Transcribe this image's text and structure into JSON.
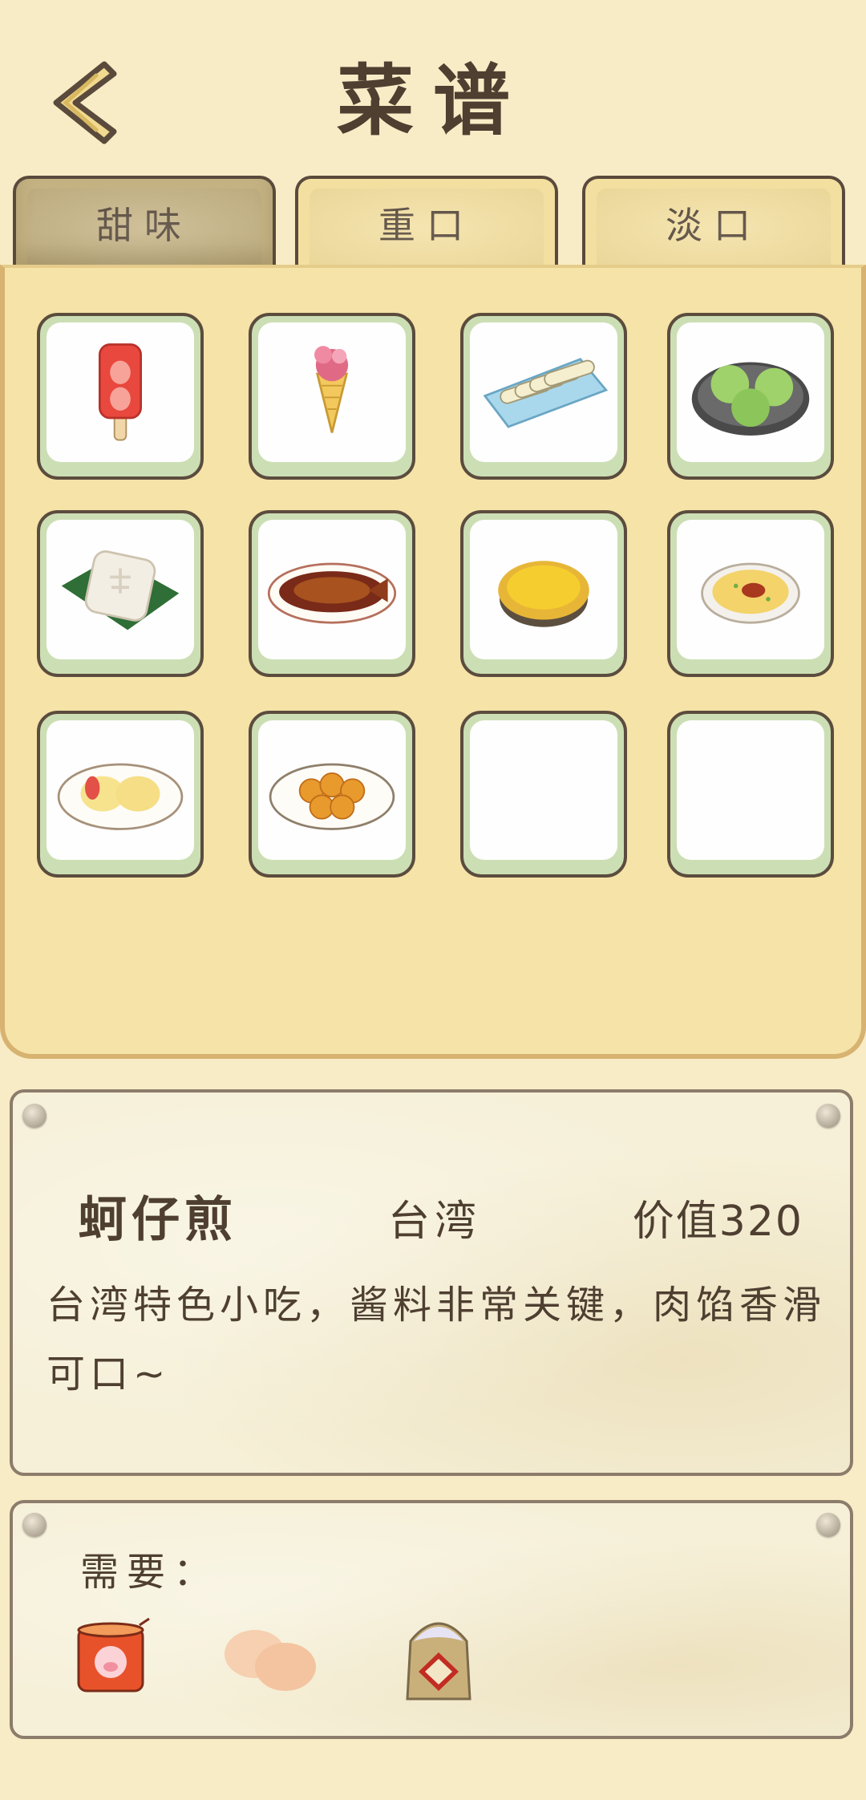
{
  "header": {
    "title": "菜谱",
    "back_icon": "chevron-left-icon"
  },
  "tabs": [
    {
      "label": "甜味",
      "active": true
    },
    {
      "label": "重口",
      "active": false
    },
    {
      "label": "淡口",
      "active": false
    }
  ],
  "grid": {
    "items": [
      {
        "icon": "strawberry-popsicle-icon"
      },
      {
        "icon": "ice-cream-cone-icon"
      },
      {
        "icon": "rice-rolls-plate-icon"
      },
      {
        "icon": "green-rice-balls-icon"
      },
      {
        "icon": "white-cake-on-leaf-icon"
      },
      {
        "icon": "braised-fish-icon"
      },
      {
        "icon": "egg-tart-icon"
      },
      {
        "icon": "oyster-omelette-icon"
      },
      {
        "icon": "pastry-plate-icon"
      },
      {
        "icon": "fried-balls-plate-icon"
      },
      {
        "icon": "empty-slot"
      },
      {
        "icon": "empty-slot"
      }
    ]
  },
  "dish": {
    "name": "蚵仔煎",
    "region": "台湾",
    "value": "价值320",
    "description": "台湾特色小吃，酱料非常关键，肉馅香滑可口~"
  },
  "requirements": {
    "label": "需要：",
    "ingredients": [
      {
        "icon": "canned-pork-icon"
      },
      {
        "icon": "eggs-icon"
      },
      {
        "icon": "flour-bag-icon"
      }
    ]
  },
  "colors": {
    "background": "#f8ecc6",
    "panel": "#f5e3a7",
    "text": "#4e3f31",
    "slot_border": "#ccdfb4"
  }
}
